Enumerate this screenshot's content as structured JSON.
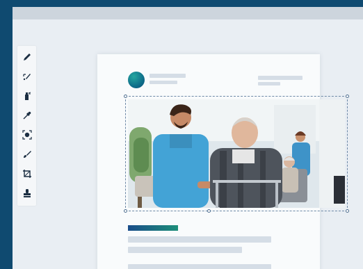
{
  "toolbar": {
    "tools": [
      {
        "icon": "pencil-icon"
      },
      {
        "icon": "selection-icon"
      },
      {
        "icon": "spray-icon"
      },
      {
        "icon": "eyedropper-icon"
      },
      {
        "icon": "face-detect-icon"
      },
      {
        "icon": "brush-icon"
      },
      {
        "icon": "crop-icon"
      },
      {
        "icon": "stamp-icon"
      }
    ]
  },
  "document": {
    "image": {
      "subject": "caregiver-with-elderly-man"
    }
  },
  "colors": {
    "background": "#0f4a70",
    "accent_start": "#1a4d8a",
    "accent_end": "#1d8f7a",
    "selection": "#6d88a6"
  }
}
